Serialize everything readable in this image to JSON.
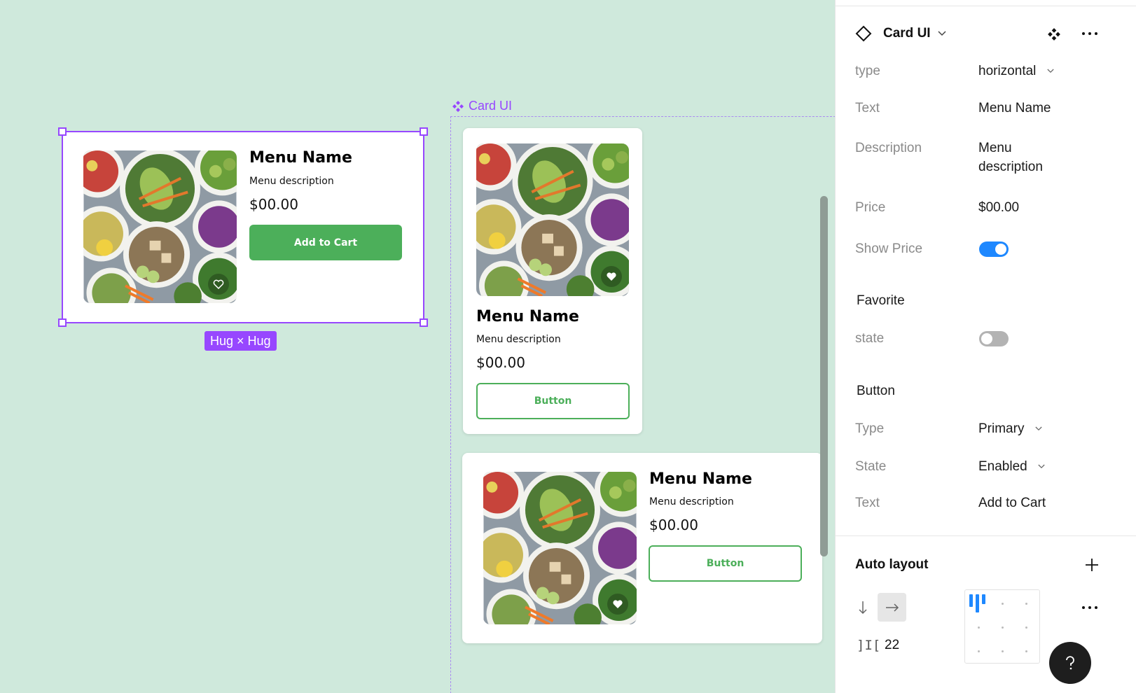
{
  "canvas": {
    "selected_card": {
      "name": "Menu Name",
      "description": "Menu description",
      "price": "$00.00",
      "button": "Add to Cart",
      "size_badge": "Hug × Hug"
    },
    "component_set": {
      "label": "Card UI",
      "vertical_card": {
        "name": "Menu Name",
        "description": "Menu description",
        "price": "$00.00",
        "button": "Button"
      },
      "horizontal_card": {
        "name": "Menu Name",
        "description": "Menu description",
        "price": "$00.00",
        "button": "Button"
      }
    }
  },
  "panel": {
    "component_name": "Card UI",
    "props": {
      "type_label": "type",
      "type_value": "horizontal",
      "text_label": "Text",
      "text_value": "Menu Name",
      "description_label": "Description",
      "description_value_1": "Menu",
      "description_value_2": "description",
      "price_label": "Price",
      "price_value": "$00.00",
      "show_price_label": "Show Price",
      "show_price_on": true
    },
    "favorite": {
      "title": "Favorite",
      "state_label": "state",
      "state_on": false
    },
    "button": {
      "title": "Button",
      "type_label": "Type",
      "type_value": "Primary",
      "state_label": "State",
      "state_value": "Enabled",
      "text_label": "Text",
      "text_value": "Add to Cart"
    },
    "auto_layout": {
      "title": "Auto layout",
      "gap": "22",
      "direction": "horizontal"
    }
  },
  "colors": {
    "canvas_bg": "#cfe9dc",
    "accent_green": "#4caf5a",
    "selection": "#9747ff",
    "toggle_on": "#1e88ff"
  }
}
